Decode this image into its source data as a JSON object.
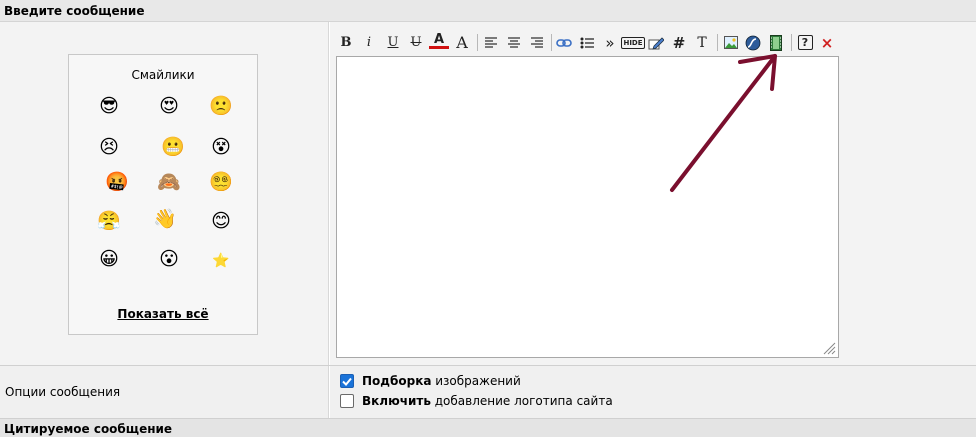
{
  "header": {
    "title": "Введите сообщение"
  },
  "smilies": {
    "title": "Смайлики",
    "show_all": "Показать всё",
    "items": [
      "😎",
      "😍",
      "🙁",
      "😣",
      "😬",
      "😵",
      "🤬",
      "🙈",
      "😵‍💫",
      "😤",
      "👋",
      "😊",
      "😀",
      "😮",
      "⭐"
    ]
  },
  "toolbar": {
    "bold": "B",
    "italic": "i",
    "underline": "U",
    "strike": "U",
    "font_color": "A",
    "font_size": "A",
    "quote": "»",
    "hide": "HIDE",
    "hash": "#",
    "text": "T",
    "help": "?",
    "remove": "×"
  },
  "editor": {
    "value": ""
  },
  "options": {
    "label": "Опции сообщения",
    "items": [
      {
        "bold": "Подборка",
        "rest": " изображений",
        "checked": true
      },
      {
        "bold": "Включить",
        "rest": " добавление логотипа сайта",
        "checked": false
      }
    ]
  },
  "footer": {
    "title": "Цитируемое сообщение"
  },
  "colors": {
    "arrow": "#7a0f2e",
    "checkbox": "#1a73d9"
  }
}
